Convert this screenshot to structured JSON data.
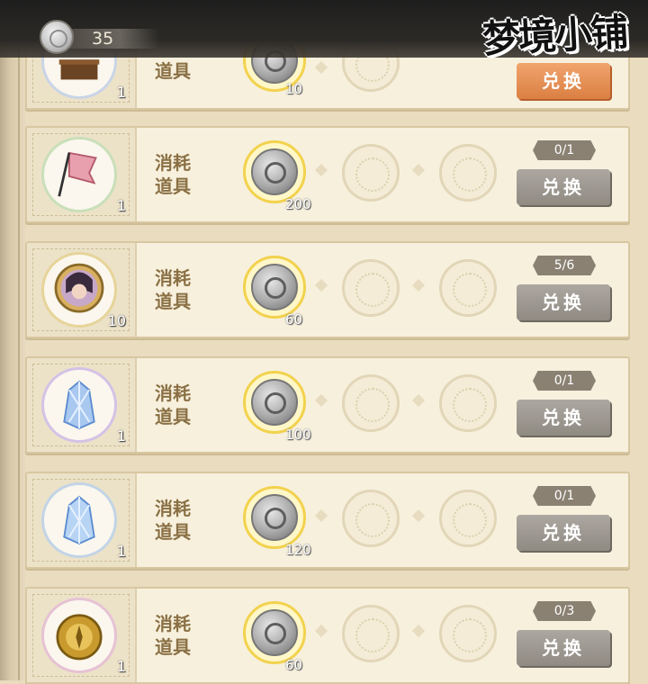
{
  "header": {
    "currency_count": "35",
    "currency_icon": "silver-coin-icon",
    "shop_title": "梦境小铺"
  },
  "rows": [
    {
      "qty": "1",
      "category": "",
      "cost": "10",
      "limit": "",
      "button": "兑换",
      "item_icon": "treasure-chest-icon",
      "button_color": "#db7f43"
    },
    {
      "qty": "1",
      "category": "消耗道具",
      "cost": "200",
      "limit": "0/1",
      "button": "兑换",
      "item_icon": "red-flag-banner-icon"
    },
    {
      "qty": "10",
      "category": "消耗道具",
      "cost": "60",
      "limit": "5/6",
      "button": "兑换",
      "item_icon": "character-portrait-medallion-icon"
    },
    {
      "qty": "1",
      "category": "消耗道具",
      "cost": "100",
      "limit": "0/1",
      "button": "兑换",
      "item_icon": "blue-crystal-icon"
    },
    {
      "qty": "1",
      "category": "消耗道具",
      "cost": "120",
      "limit": "0/1",
      "button": "兑换",
      "item_icon": "blue-crystal-icon"
    },
    {
      "qty": "1",
      "category": "消耗道具",
      "cost": "60",
      "limit": "0/3",
      "button": "兑换",
      "item_icon": "golden-compass-icon"
    }
  ]
}
